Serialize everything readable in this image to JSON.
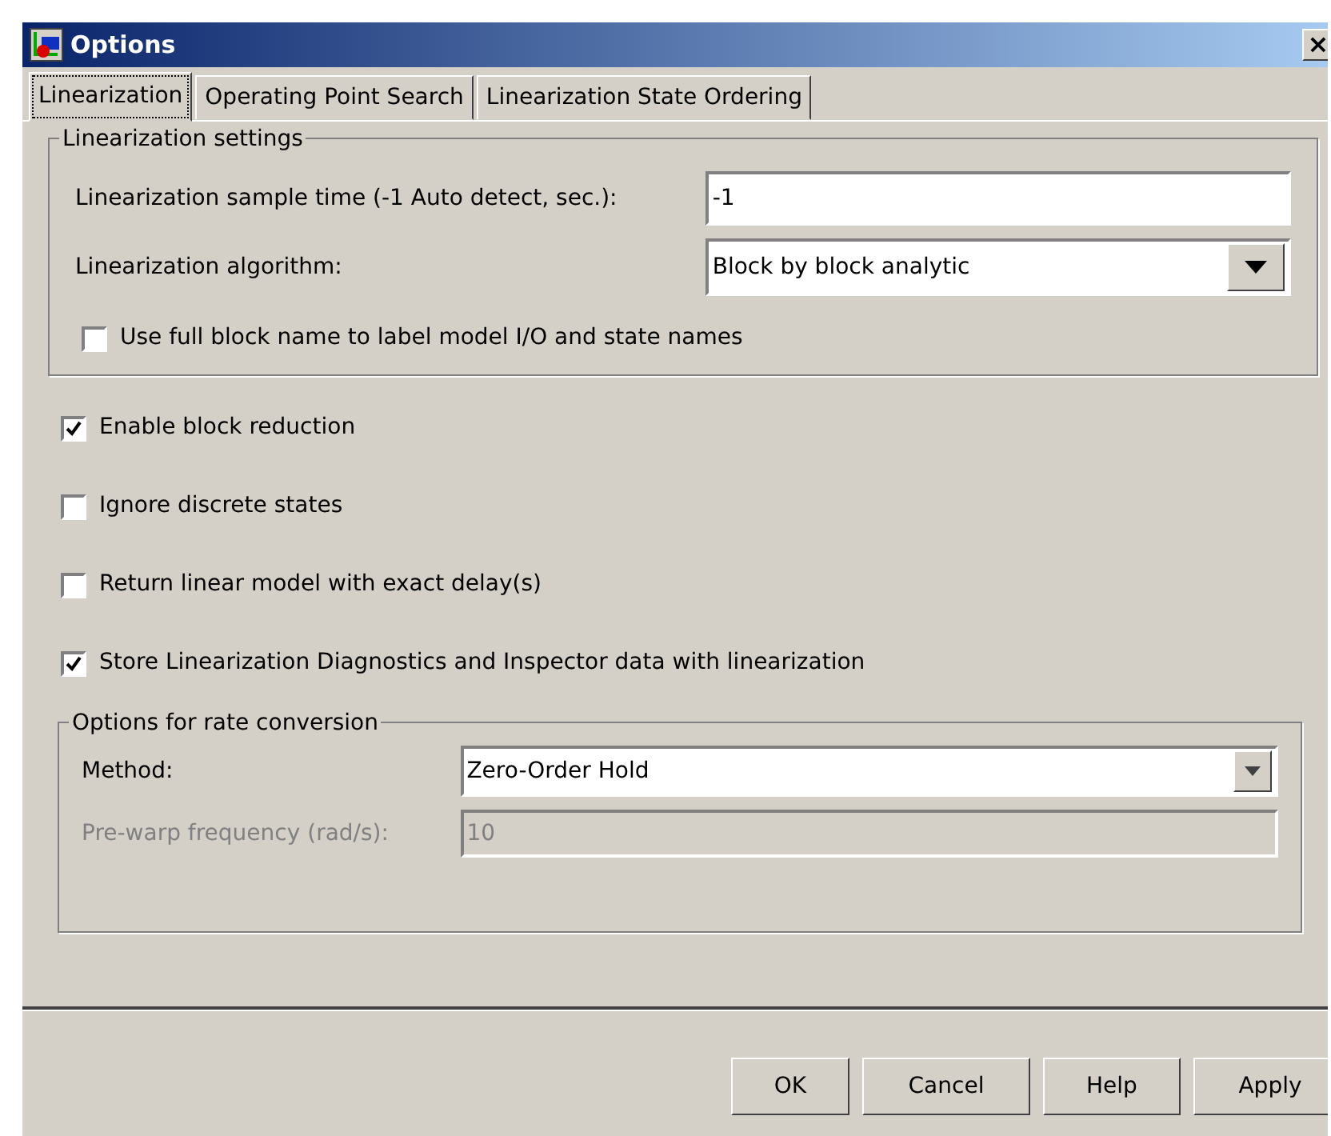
{
  "window": {
    "title": "Options",
    "close": "×"
  },
  "tabs": [
    {
      "label": "Linearization",
      "selected": true
    },
    {
      "label": "Operating Point Search",
      "selected": false
    },
    {
      "label": "Linearization State Ordering",
      "selected": false
    }
  ],
  "linearization_settings": {
    "title": "Linearization settings",
    "sample_time": {
      "label": "Linearization sample time (-1 Auto detect, sec.):",
      "value": "-1"
    },
    "algorithm": {
      "label": "Linearization algorithm:",
      "value": "Block by block analytic"
    },
    "full_name": {
      "label": "Use full block name to label model I/O and state names",
      "checked": false
    }
  },
  "options": [
    {
      "label": "Enable block reduction",
      "checked": true
    },
    {
      "label": "Ignore discrete states",
      "checked": false
    },
    {
      "label": "Return linear model with exact delay(s)",
      "checked": false
    },
    {
      "label": "Store Linearization Diagnostics and Inspector data with linearization",
      "checked": true
    }
  ],
  "rate_conversion": {
    "title": "Options for rate conversion",
    "method": {
      "label": "Method:",
      "value": "Zero-Order Hold"
    },
    "prewarp": {
      "label": "Pre-warp frequency (rad/s):",
      "value": "10",
      "disabled": true
    }
  },
  "buttons": [
    "OK",
    "Cancel",
    "Help",
    "Apply"
  ]
}
